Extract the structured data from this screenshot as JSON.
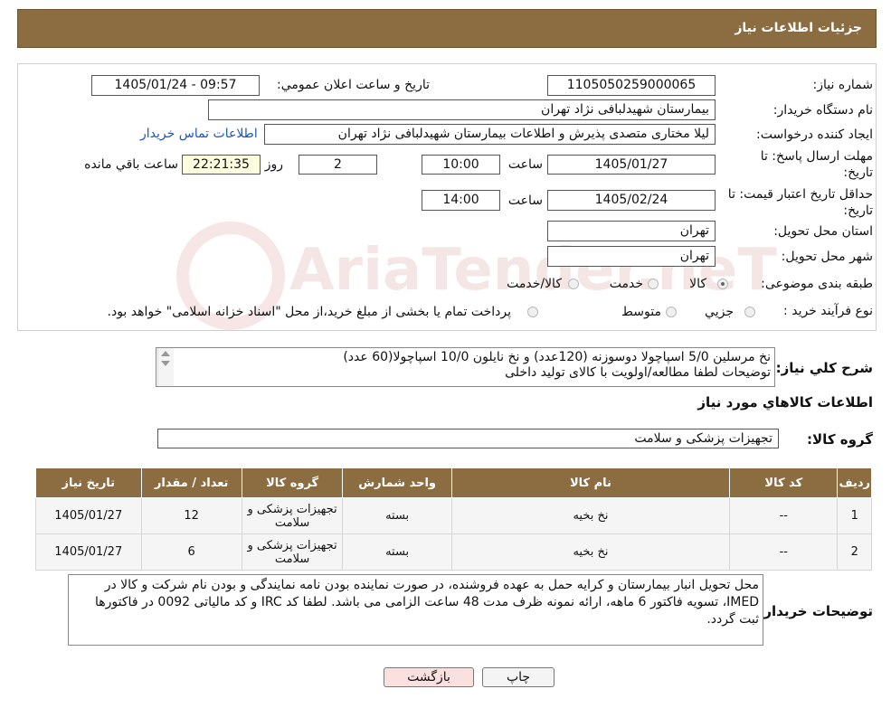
{
  "header": {
    "title": "جزئیات اطلاعات نیاز"
  },
  "fields": {
    "need_number_label": "شماره نیاز:",
    "need_number": "1105050259000065",
    "announce_label": "تاریخ و ساعت اعلان عمومي:",
    "announce_value": "1405/01/24 - 09:57",
    "buyer_org_label": "نام دستگاه خريدار:",
    "buyer_org": "بیمارستان شهیدلبافی نژاد تهران",
    "creator_label": "ايجاد کننده درخواست:",
    "creator": "لیلا مختاری متصدی پذیرش و اطلاعات بیمارستان شهیدلبافی نژاد تهران",
    "contact_link": "اطلاعات تماس خريدار",
    "deadline_label": "مهلت ارسال پاسخ: تا تاريخ:",
    "deadline_date": "1405/01/27",
    "time_label": "ساعت",
    "deadline_time": "10:00",
    "days_value": "2",
    "days_label": "روز و",
    "remaining_time": "22:21:35",
    "remaining_label": "ساعت باقي مانده",
    "validity_label": "حداقل تاريخ اعتبار قيمت: تا تاريخ:",
    "validity_date": "1405/02/24",
    "validity_time": "14:00",
    "province_label": "استان محل تحويل:",
    "province": "تهران",
    "city_label": "شهر محل تحويل:",
    "city": "تهران",
    "category_label": "طبقه بندی موضوعی:",
    "category_options": [
      "کالا",
      "خدمت",
      "کالا/خدمت"
    ],
    "purchase_label": "نوع فرآيند خريد :",
    "purchase_options": [
      "جزيي",
      "متوسط"
    ],
    "purchase_note": "پرداخت تمام یا بخشی از مبلغ خرید،از محل \"اسناد خزانه اسلامی\" خواهد بود."
  },
  "summary": {
    "label": "شرح کلي نياز:",
    "line1": "نخ مرسلین 5/0 اسپاچولا دوسوزنه (120عدد) و نخ نایلون 10/0 اسپاچولا(60 عدد)",
    "line2": "توضیحات لطفا مطالعه/اولویت با کالای تولید داخلی"
  },
  "items_section": {
    "title": "اطلاعات کالاهاي مورد نياز",
    "group_label": "گروه کالا:",
    "group_value": "تجهیزات پزشکی و سلامت",
    "columns": [
      "رديف",
      "کد کالا",
      "نام کالا",
      "واحد شمارش",
      "گروه کالا",
      "تعداد / مقدار",
      "تاريخ نياز"
    ],
    "rows": [
      {
        "row": "1",
        "code": "--",
        "name": "نخ بخیه",
        "unit": "بسته",
        "group": "تجهیزات پزشکی و سلامت",
        "qty": "12",
        "date": "1405/01/27"
      },
      {
        "row": "2",
        "code": "--",
        "name": "نخ بخیه",
        "unit": "بسته",
        "group": "تجهیزات پزشکی و سلامت",
        "qty": "6",
        "date": "1405/01/27"
      }
    ]
  },
  "buyer_notes": {
    "label": "توضيحات خريدار:",
    "text": "محل تحویل انبار بیمارستان و کرایه حمل به عهده فروشنده، در صورت نماینده بودن نامه نمایندگی و بودن نام شرکت و کالا در IMED، تسویه فاکتور 6 ماهه، ارائه نمونه ظرف مدت 48 ساعت الزامی می باشد. لطفا کد IRC و کد مالیاتی 0092 در فاکتورها ثبت گردد."
  },
  "buttons": {
    "print": "چاپ",
    "back": "بازگشت"
  },
  "watermark": {
    "text": "AriaTender.neT"
  },
  "colors": {
    "header_bg": "#8c6d42",
    "link": "#1a56c7",
    "back_button_bg": "#fbe0e0"
  }
}
